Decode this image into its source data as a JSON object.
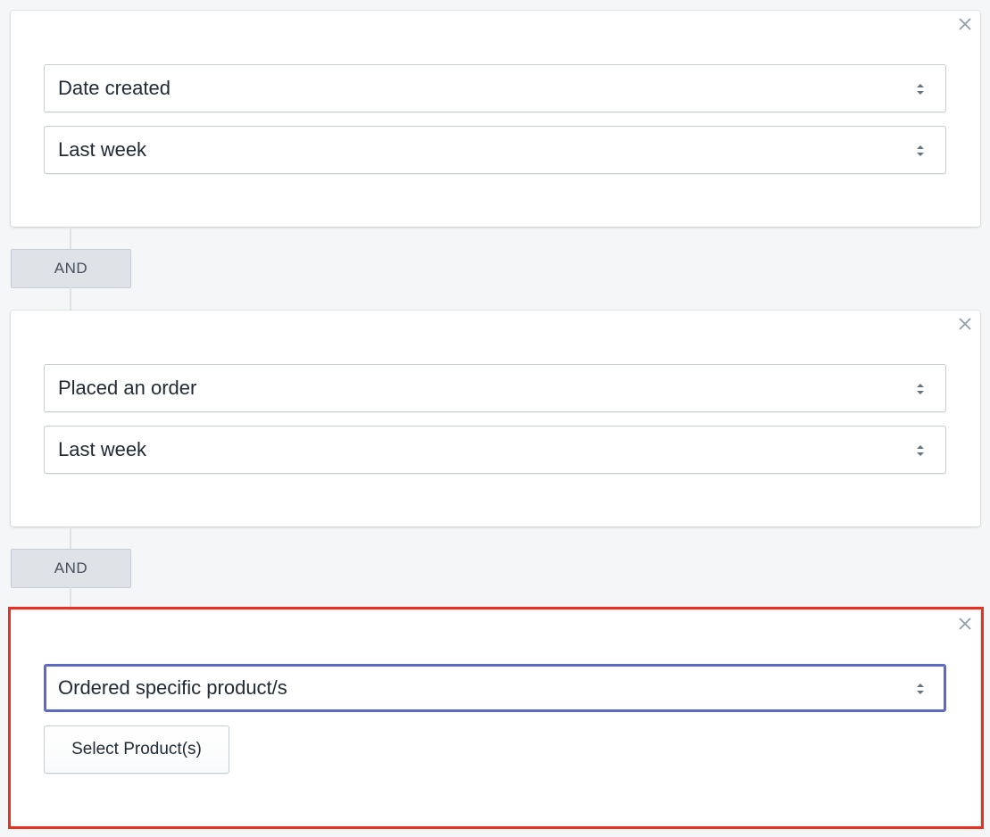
{
  "conditions": [
    {
      "field": "Date created",
      "value": "Last week"
    },
    {
      "field": "Placed an order",
      "value": "Last week"
    },
    {
      "field": "Ordered specific product/s",
      "button_label": "Select Product(s)"
    }
  ],
  "connectors": [
    "AND",
    "AND"
  ],
  "icons": {
    "close": "close-icon",
    "select_arrows": "chevron-up-down-icon"
  },
  "colors": {
    "background": "#f4f6f8",
    "focus_border": "#5c6ac4",
    "highlight_border": "#e8321f",
    "connector_button": "#dfe3e8"
  }
}
